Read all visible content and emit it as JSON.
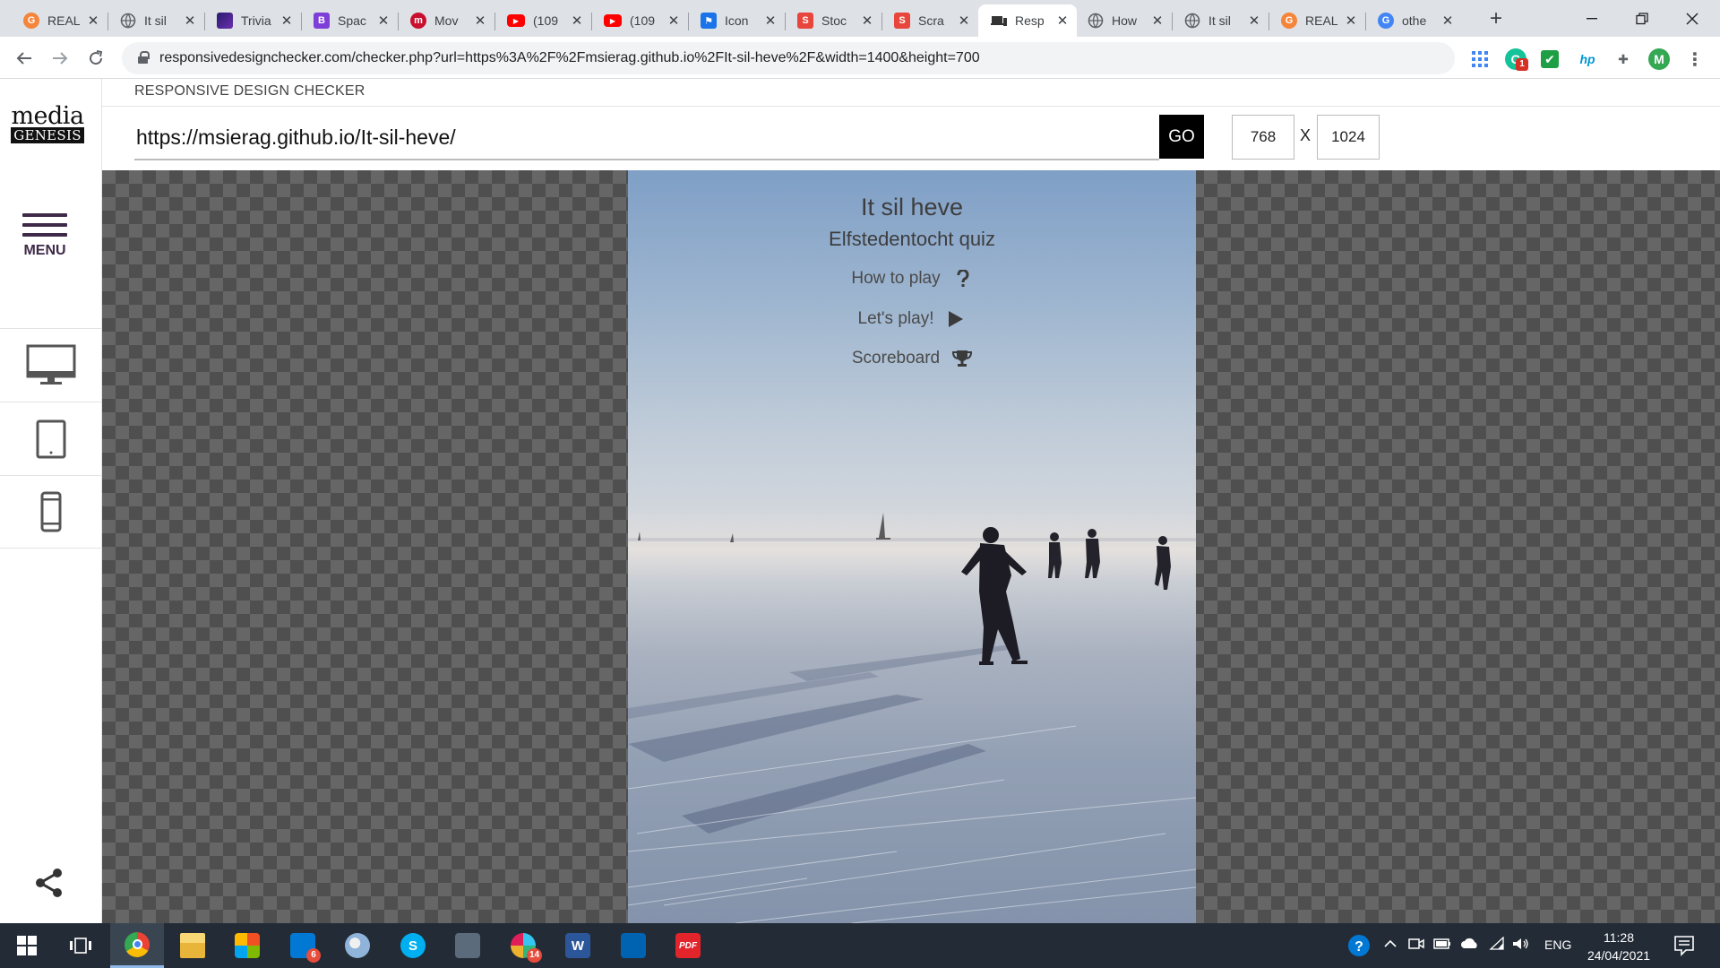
{
  "browser": {
    "tabs": [
      {
        "title": "REAL",
        "icon": "g-logo-icon",
        "color": "#f4853a",
        "glyph": "G",
        "active": false
      },
      {
        "title": "It sil",
        "icon": "globe-icon",
        "color": "#5f6368",
        "glyph": "",
        "active": false
      },
      {
        "title": "Trivia",
        "icon": "trivia-icon",
        "color": "#4b2a7b",
        "glyph": "",
        "active": false
      },
      {
        "title": "Spac",
        "icon": "b-logo-icon",
        "color": "#7e3fd9",
        "glyph": "B",
        "active": false
      },
      {
        "title": "Mov",
        "icon": "m-logo-icon",
        "color": "#c8102e",
        "glyph": "m",
        "active": false
      },
      {
        "title": "(109",
        "icon": "youtube-icon",
        "color": "#ff0000",
        "glyph": "▶",
        "active": false
      },
      {
        "title": "(109",
        "icon": "youtube-icon",
        "color": "#ff0000",
        "glyph": "▶",
        "active": false
      },
      {
        "title": "Icon",
        "icon": "flag-icon",
        "color": "#1a73e8",
        "glyph": "⚑",
        "active": false
      },
      {
        "title": "Stoc",
        "icon": "scratch-icon",
        "color": "#e8453c",
        "glyph": "S",
        "active": false
      },
      {
        "title": "Scra",
        "icon": "scratch-icon",
        "color": "#e8453c",
        "glyph": "S",
        "active": false
      },
      {
        "title": "Resp",
        "icon": "devices-icon",
        "color": "#333333",
        "glyph": "",
        "active": true
      },
      {
        "title": "How",
        "icon": "globe-icon",
        "color": "#5f6368",
        "glyph": "",
        "active": false
      },
      {
        "title": "It sil",
        "icon": "globe-icon",
        "color": "#5f6368",
        "glyph": "",
        "active": false
      },
      {
        "title": "REAL",
        "icon": "g-logo-icon",
        "color": "#f4853a",
        "glyph": "G",
        "active": false
      },
      {
        "title": "othe",
        "icon": "google-icon",
        "color": "#4285f4",
        "glyph": "G",
        "active": false
      }
    ],
    "new_tab": "+",
    "url": "responsivedesignchecker.com/checker.php?url=https%3A%2F%2Fmsierag.github.io%2FIt-sil-heve%2F&width=1400&height=700",
    "extensions": [
      {
        "name": "grammarly-icon",
        "glyph": "G",
        "color": "#15c39a",
        "badge": "1"
      },
      {
        "name": "check-icon",
        "glyph": "✔",
        "color": "#1e9e45",
        "badge": ""
      },
      {
        "name": "hp-icon",
        "glyph": "hp",
        "color": "#0096d6",
        "badge": ""
      },
      {
        "name": "puzzle-icon",
        "glyph": "✚",
        "color": "#5f6368",
        "badge": ""
      },
      {
        "name": "profile-avatar",
        "glyph": "M",
        "color": "#34a853",
        "badge": ""
      }
    ]
  },
  "site": {
    "logo_top": "media",
    "logo_bottom": "GENESIS",
    "menu_label": "MENU",
    "heading": "RESPONSIVE DESIGN CHECKER",
    "url_value": "https://msierag.github.io/It-sil-heve/",
    "go_label": "GO",
    "width_value": "768",
    "height_value": "1024",
    "dim_separator": "X"
  },
  "app": {
    "title": "It sil heve",
    "subtitle": "Elfstedentocht quiz",
    "menu": [
      {
        "label": "How to play",
        "icon": "question-icon"
      },
      {
        "label": "Let's play!",
        "icon": "play-icon"
      },
      {
        "label": "Scoreboard",
        "icon": "trophy-icon"
      }
    ]
  },
  "taskbar": {
    "apps": [
      {
        "name": "chrome-icon",
        "color": "#e94235",
        "active": true,
        "badge": ""
      },
      {
        "name": "file-explorer-icon",
        "color": "#f2c94c",
        "active": false,
        "badge": ""
      },
      {
        "name": "store-icon",
        "color": "#f25022",
        "active": false,
        "badge": ""
      },
      {
        "name": "mail-icon",
        "color": "#0078d4",
        "active": false,
        "badge": "6"
      },
      {
        "name": "paint-icon",
        "color": "#8fb3d9",
        "active": false,
        "badge": ""
      },
      {
        "name": "skype-icon",
        "color": "#00aff0",
        "active": false,
        "badge": ""
      },
      {
        "name": "calculator-icon",
        "color": "#5b6b7b",
        "active": false,
        "badge": ""
      },
      {
        "name": "slack-icon",
        "color": "#e01e5a",
        "active": false,
        "badge": "14"
      },
      {
        "name": "word-icon",
        "color": "#2b579a",
        "active": false,
        "badge": ""
      },
      {
        "name": "photos-icon",
        "color": "#0063b1",
        "active": false,
        "badge": ""
      },
      {
        "name": "pdf-icon",
        "color": "#e3242b",
        "active": false,
        "badge": ""
      }
    ],
    "app_glyphs": [
      "",
      "",
      "",
      "",
      "",
      "S",
      "",
      "",
      "W",
      "",
      "PDF"
    ],
    "language": "ENG",
    "time": "11:28",
    "date": "24/04/2021"
  }
}
